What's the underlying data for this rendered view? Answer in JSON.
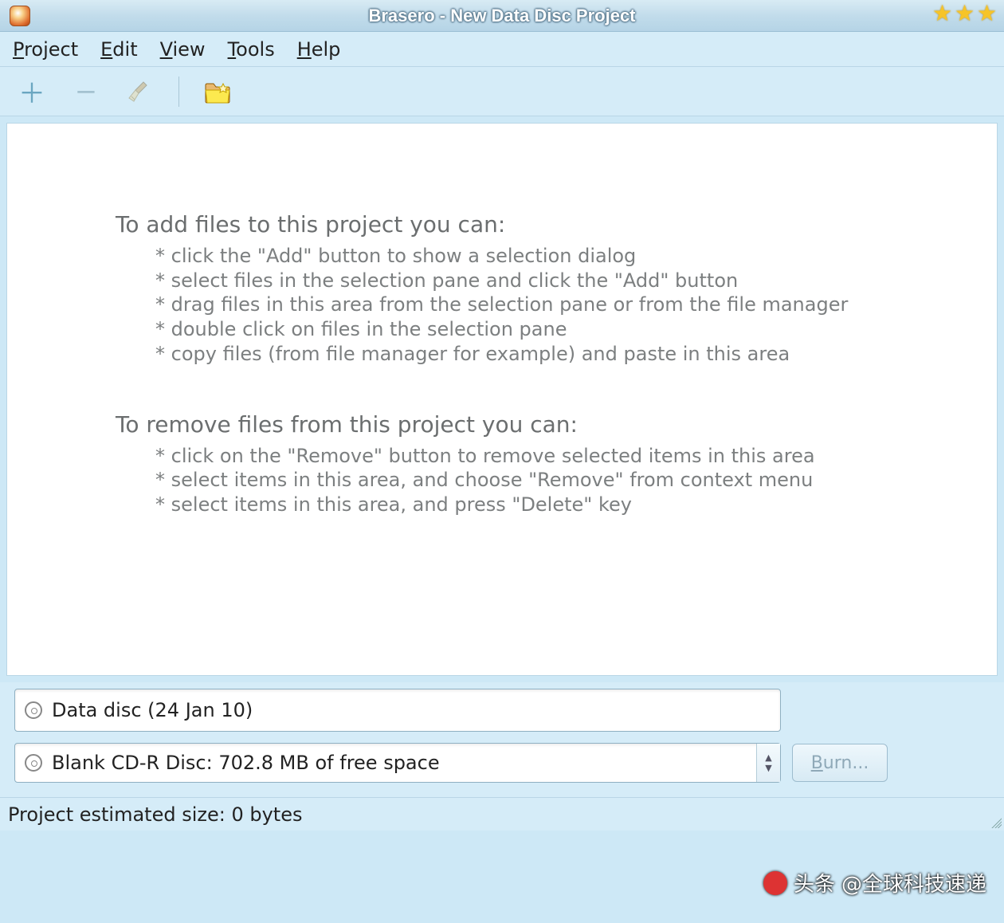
{
  "window": {
    "title": "Brasero - New Data Disc Project"
  },
  "menu": {
    "project": "Project",
    "edit": "Edit",
    "view": "View",
    "tools": "Tools",
    "help": "Help"
  },
  "toolbar": {
    "add": "add",
    "remove": "remove",
    "clear": "clear",
    "new_folder": "new-folder"
  },
  "help_add": {
    "heading": "To add files to this project you can:",
    "items": [
      "click the \"Add\" button to show a selection dialog",
      "select files in the selection pane and click the \"Add\" button",
      "drag files in this area from the selection pane or from the file manager",
      "double click on files in the selection pane",
      "copy files (from file manager for example) and paste in this area"
    ]
  },
  "help_remove": {
    "heading": "To remove files from this project you can:",
    "items": [
      "click on the \"Remove\" button to remove selected items in this area",
      "select items in this area, and choose \"Remove\" from context menu",
      "select items in this area, and press \"Delete\" key"
    ]
  },
  "disc": {
    "name_value": "Data disc (24 Jan 10)",
    "target_value": "Blank CD-R Disc: 702.8 MB of free space",
    "burn_label": "Burn..."
  },
  "status": {
    "text": "Project estimated size: 0 bytes"
  },
  "watermark": {
    "label1": "头条",
    "label2": "@全球科技速递"
  }
}
